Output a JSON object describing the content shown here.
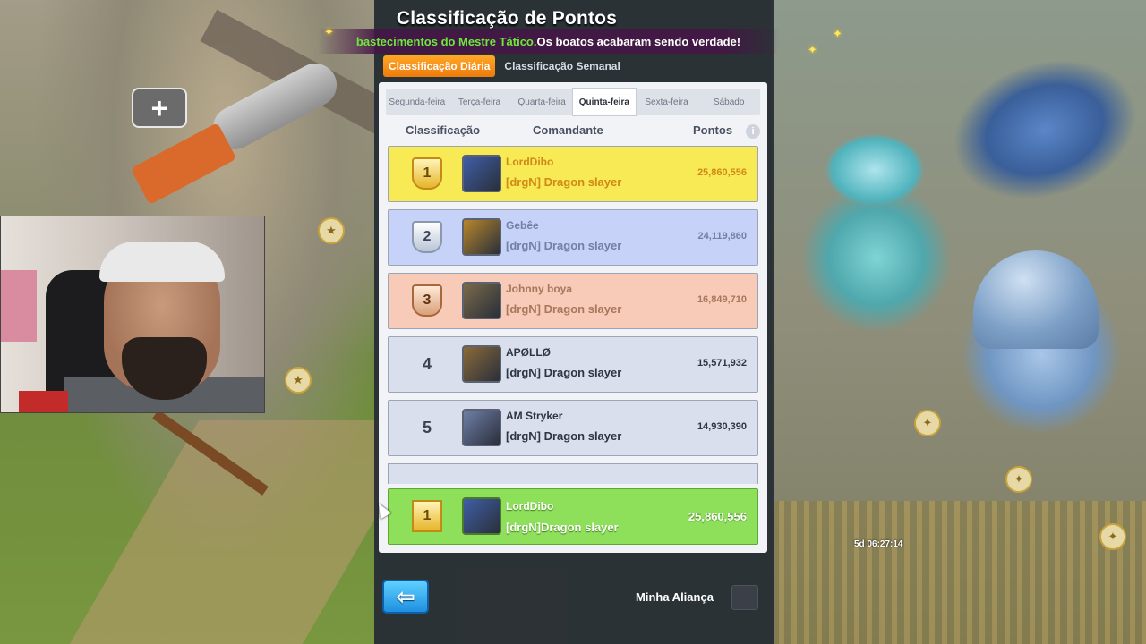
{
  "header": {
    "title": "Classificação de Pontos",
    "ticker_highlight": "bastecimentos do Mestre Tático.",
    "ticker_rest": " Os boatos acabaram sendo verdade!"
  },
  "main_tabs": [
    {
      "label": "Classificação Diária",
      "active": true
    },
    {
      "label": "Classificação Semanal",
      "active": false
    }
  ],
  "day_tabs": [
    {
      "label": "Segunda-feira",
      "active": false
    },
    {
      "label": "Terça-feira",
      "active": false
    },
    {
      "label": "Quarta-feira",
      "active": false
    },
    {
      "label": "Quinta-feira",
      "active": true
    },
    {
      "label": "Sexta-feira",
      "active": false
    },
    {
      "label": "Sábado",
      "active": false
    }
  ],
  "columns": {
    "rank": "Classificação",
    "commander": "Comandante",
    "points": "Pontos",
    "info_icon": "i"
  },
  "rows": [
    {
      "rank": "1",
      "name": "LordDibo",
      "alliance": "[drgN] Dragon slayer",
      "points": "25,860,556",
      "avatar_color": "#3f5fa8"
    },
    {
      "rank": "2",
      "name": "Gebêe",
      "alliance": "[drgN] Dragon slayer",
      "points": "24,119,860",
      "avatar_color": "#b8862a"
    },
    {
      "rank": "3",
      "name": "Johnny boya",
      "alliance": "[drgN] Dragon slayer",
      "points": "16,849,710",
      "avatar_color": "#7a6a4a"
    },
    {
      "rank": "4",
      "name": "APØLLØ",
      "alliance": "[drgN] Dragon slayer",
      "points": "15,571,932",
      "avatar_color": "#8a6a3a"
    },
    {
      "rank": "5",
      "name": "AM Stryker",
      "alliance": "[drgN] Dragon slayer",
      "points": "14,930,390",
      "avatar_color": "#6f7fa8"
    }
  ],
  "my_row": {
    "rank": "1",
    "name": "LordDibo",
    "alliance": "[drgN]Dragon slayer",
    "points": "25,860,556",
    "avatar_color": "#3f5fa8"
  },
  "footer": {
    "back_glyph": "⇦",
    "my_alliance_label": "Minha Aliança",
    "my_alliance_checked": false
  },
  "world": {
    "plus_glyph": "+",
    "timer": "5d 06:27:14"
  },
  "colors": {
    "accent_orange": "#ee7c0b",
    "row_gold": "#f7ea55",
    "row_silver": "#c6d2f7",
    "row_bronze": "#f7cbb8",
    "row_self": "#8ee05a"
  }
}
